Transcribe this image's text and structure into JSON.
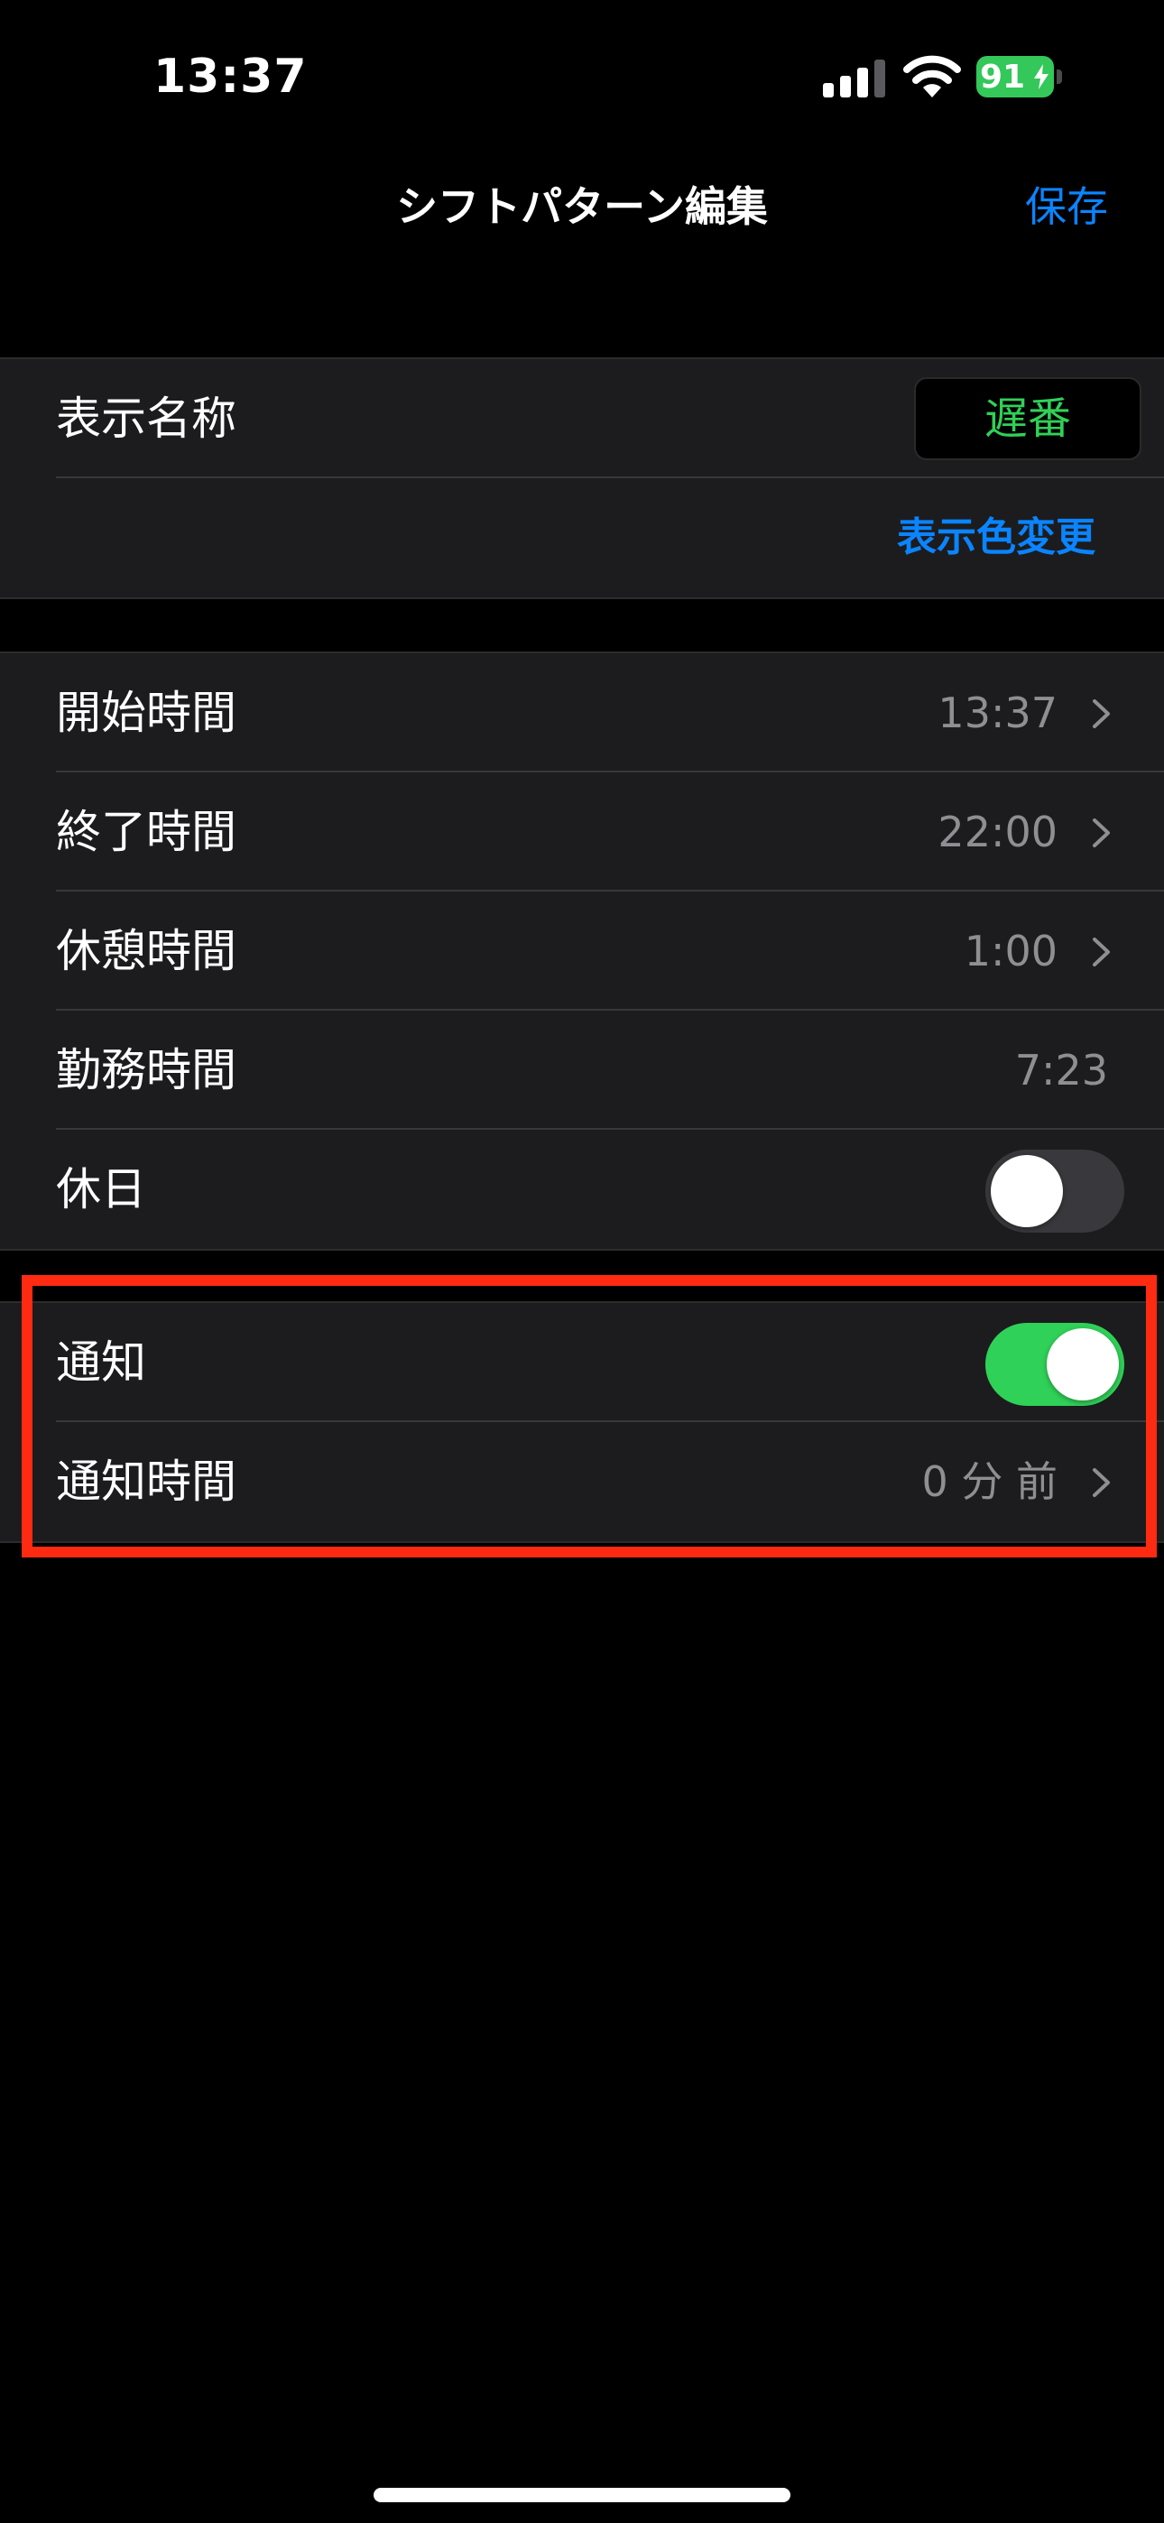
{
  "status_bar": {
    "time": "13:37",
    "battery": "91",
    "icons": [
      "signal-icon",
      "wifi-icon",
      "battery-icon",
      "charging-bolt-icon"
    ]
  },
  "nav": {
    "title": "シフトパターン編集",
    "save_label": "保存"
  },
  "display_group": {
    "name_label": "表示名称",
    "name_value": "遅番",
    "color_change_label": "表示色変更"
  },
  "time_group": {
    "rows": [
      {
        "label": "開始時間",
        "value": "13:37"
      },
      {
        "label": "終了時間",
        "value": "22:00"
      },
      {
        "label": "休憩時間",
        "value": "1:00"
      },
      {
        "label": "勤務時間",
        "value": "7:23"
      },
      {
        "label": "休日",
        "toggle": false
      }
    ]
  },
  "notification_group": {
    "notify_label": "通知",
    "notify_on": true,
    "time_label": "通知時間",
    "time_value": "0 分 前"
  },
  "colors": {
    "accent": "#0a84ff",
    "toggle_on": "#30d158",
    "highlight": "#ff2a12",
    "name_text": "#30d158"
  }
}
